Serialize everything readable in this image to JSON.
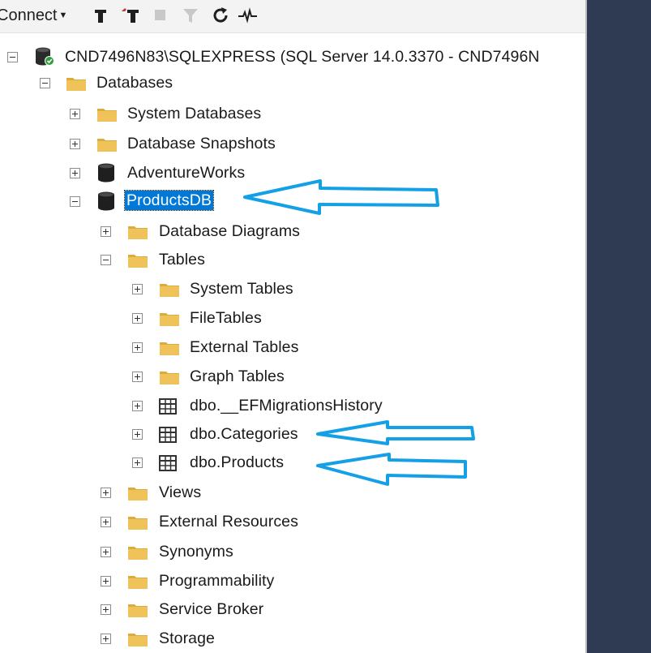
{
  "toolbar": {
    "connect_label": "Connect",
    "icons": [
      "connect-filter-icon",
      "disconnect-icon",
      "stop-icon",
      "filter-icon",
      "refresh-icon",
      "activity-monitor-icon"
    ]
  },
  "tree": {
    "server": "CND7496N83\\SQLEXPRESS (SQL Server 14.0.3370 - CND7496N",
    "databases": "Databases",
    "system_databases": "System Databases",
    "database_snapshots": "Database Snapshots",
    "adventureworks": "AdventureWorks",
    "productsdb": "ProductsDB",
    "database_diagrams": "Database Diagrams",
    "tables": "Tables",
    "system_tables": "System Tables",
    "filetables": "FileTables",
    "external_tables": "External Tables",
    "graph_tables": "Graph Tables",
    "ef_migrations": "dbo.__EFMigrationsHistory",
    "categories": "dbo.Categories",
    "products": "dbo.Products",
    "views": "Views",
    "external_resources": "External Resources",
    "synonyms": "Synonyms",
    "programmability": "Programmability",
    "service_broker": "Service Broker",
    "storage": "Storage"
  },
  "colors": {
    "selection": "#0078d7",
    "folder": "#e8b84a",
    "annotation_arrow": "#14a0e6",
    "side_panel": "#2f3a53"
  }
}
